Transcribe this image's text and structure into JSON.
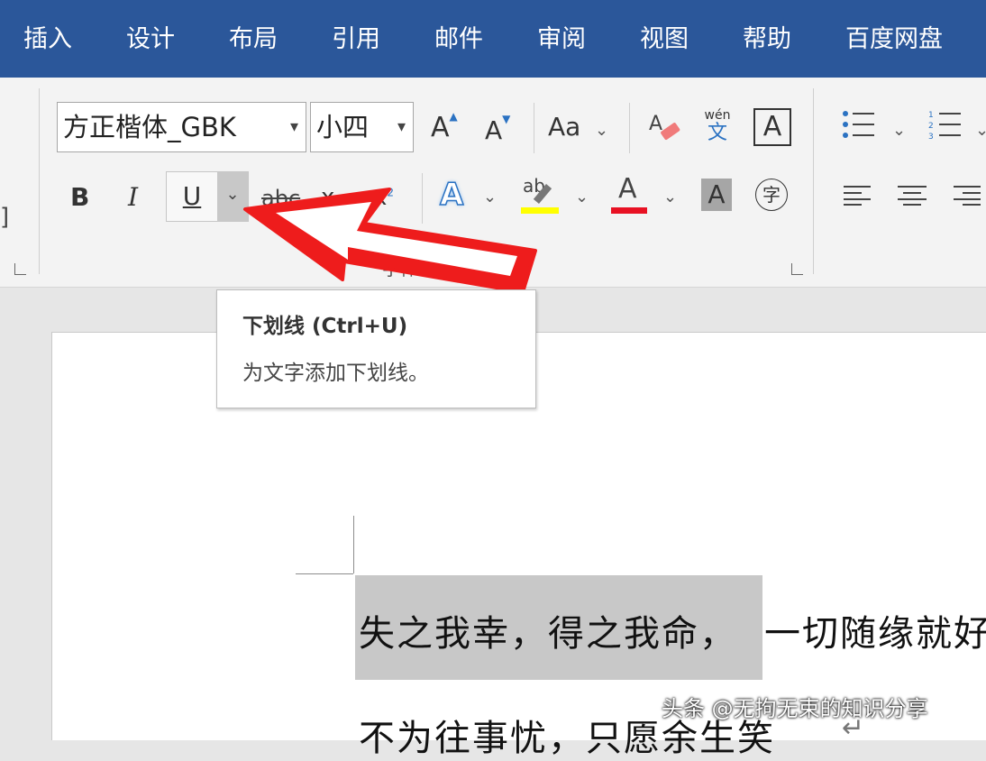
{
  "ribbon_tabs": [
    "插入",
    "设计",
    "布局",
    "引用",
    "邮件",
    "审阅",
    "视图",
    "帮助",
    "百度网盘"
  ],
  "font_group": {
    "font_name": "方正楷体_GBK",
    "font_size": "小四",
    "grow_font": "A",
    "shrink_font": "A",
    "change_case": "Aa",
    "phonetic_top": "wén",
    "phonetic_bottom": "文",
    "char_border": "A",
    "bold": "B",
    "italic": "I",
    "underline": "U",
    "strikethrough": "abc",
    "subscript": "x",
    "superscript": "x",
    "text_effects": "A",
    "highlight": "ab",
    "font_color": "A",
    "char_shading": "A",
    "enclose_chars": "字",
    "group_label": "字体"
  },
  "tooltip": {
    "title": "下划线 (Ctrl+U)",
    "description": "为文字添加下划线。"
  },
  "document": {
    "line1_selected": "失之我幸，得之我命，",
    "line1_rest": "一切随缘就好",
    "line2": "不为往事忧，只愿余生笑"
  },
  "watermark": "头条 @无拘无束的知识分享",
  "colors": {
    "tab_bar": "#2b579a",
    "highlight_yellow": "#ffff00",
    "font_color_red": "#e81123",
    "arrow_red": "#ee1c1c",
    "selection_gray": "#c8c8c8"
  }
}
